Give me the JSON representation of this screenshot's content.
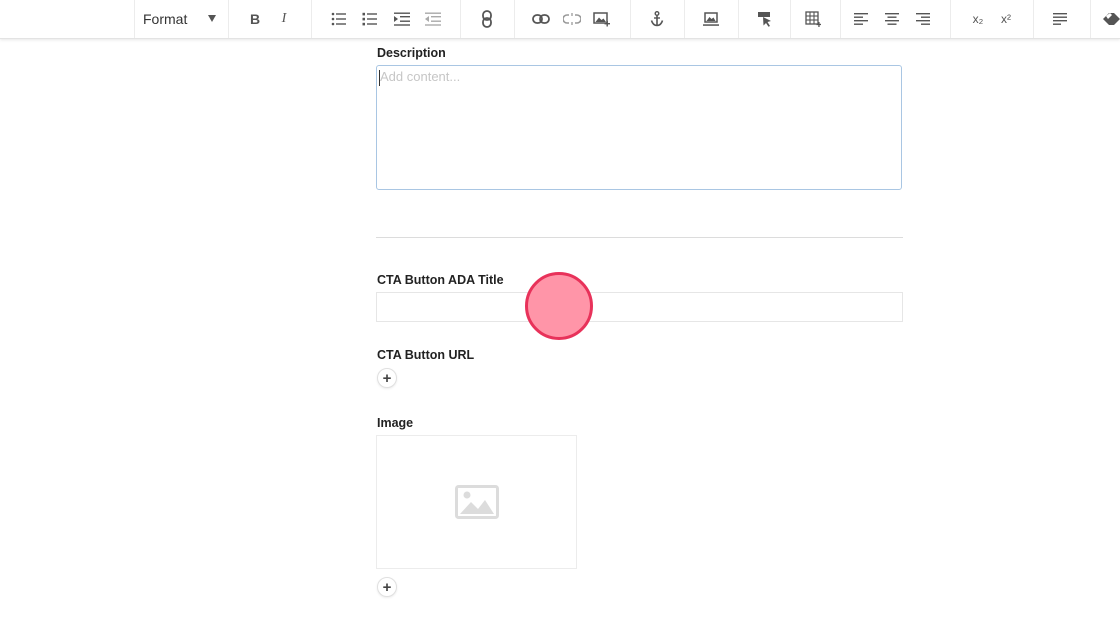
{
  "toolbar": {
    "format_label": "Format",
    "bold_label": "B",
    "italic_label": "I",
    "subscript_label": "x₂",
    "superscript_label": "x²"
  },
  "description": {
    "label": "Description",
    "placeholder": "Add content..."
  },
  "cta_title": {
    "label": "CTA Button ADA Title",
    "value": ""
  },
  "cta_url": {
    "label": "CTA Button URL",
    "add_symbol": "+"
  },
  "image": {
    "label": "Image",
    "add_symbol": "+"
  },
  "colors": {
    "focus_border": "#a9c6e3",
    "click_marker_fill": "#ff95a8",
    "click_marker_border": "#e8325a"
  }
}
